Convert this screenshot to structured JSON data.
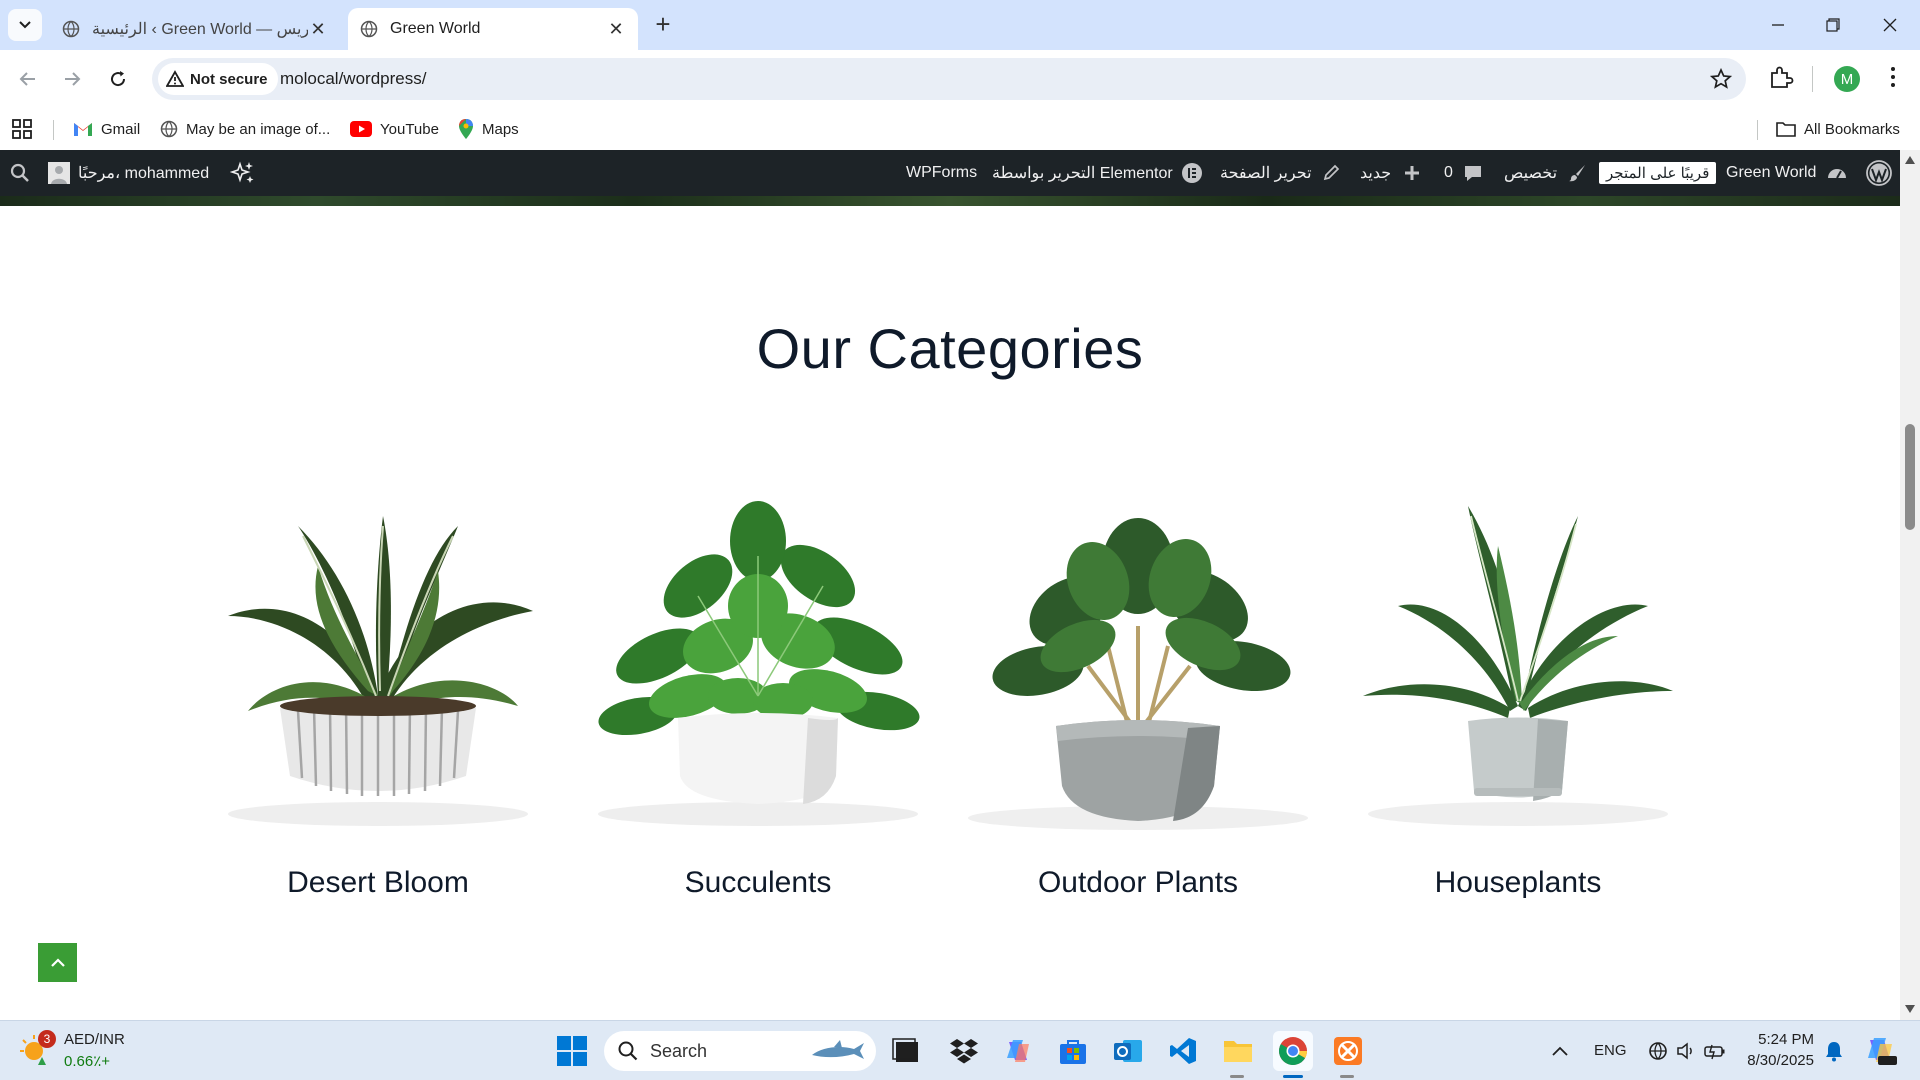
{
  "browser": {
    "tabs": [
      {
        "title": "الرئيسية ‹ Green World — ووردبريس",
        "active": false
      },
      {
        "title": "Green World",
        "active": true
      }
    ],
    "security_label": "Not secure",
    "url": "molocal/wordpress/",
    "profile_initial": "M",
    "bookmarks": [
      {
        "label": "Gmail",
        "icon": "gmail-icon"
      },
      {
        "label": "May be an image of...",
        "icon": "globe-icon"
      },
      {
        "label": "YouTube",
        "icon": "youtube-icon"
      },
      {
        "label": "Maps",
        "icon": "maps-icon"
      }
    ],
    "all_bookmarks": "All Bookmarks"
  },
  "wp_admin_bar": {
    "site_name": "Green World",
    "store_badge": "قريبًا على المتجر",
    "customize": "تخصيص",
    "comments_count": "0",
    "new": "جديد",
    "edit_page": "تحرير الصفحة",
    "elementor": "التحرير بواسطة Elementor",
    "wpforms": "WPForms",
    "greeting": "مرحبًا، mohammed"
  },
  "page": {
    "heading": "Our Categories",
    "categories": [
      {
        "label": "Desert Bloom"
      },
      {
        "label": "Succulents"
      },
      {
        "label": "Outdoor Plants"
      },
      {
        "label": "Houseplants"
      }
    ]
  },
  "taskbar": {
    "widget_badge": "3",
    "widget_title": "AED/INR",
    "widget_value": "0.66٪+",
    "search_placeholder": "Search",
    "language": "ENG",
    "time": "5:24 PM",
    "date": "8/30/2025"
  },
  "colors": {
    "tabstrip": "#d3e3fd",
    "wp_bar": "#1d2327",
    "accent_green": "#3a9d35",
    "heading": "#0f1a2a"
  }
}
